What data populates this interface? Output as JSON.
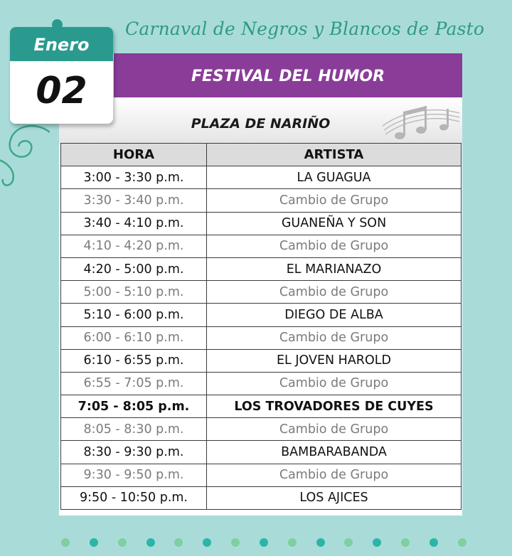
{
  "banner": {
    "title": "Carnaval de Negros y Blancos de Pasto"
  },
  "date": {
    "month": "Enero",
    "day": "02"
  },
  "festival": {
    "title": "FESTIVAL DEL HUMOR",
    "venue": "PLAZA DE NARIÑO"
  },
  "table": {
    "headers": [
      "HORA",
      "ARTISTA"
    ],
    "rows": [
      {
        "time": "3:00 - 3:30 p.m.",
        "artist": "LA GUAGUA",
        "kind": "act"
      },
      {
        "time": "3:30 - 3:40 p.m.",
        "artist": "Cambio de Grupo",
        "kind": "change"
      },
      {
        "time": "3:40 - 4:10 p.m.",
        "artist": "GUANEÑA Y SON",
        "kind": "act"
      },
      {
        "time": "4:10 - 4:20 p.m.",
        "artist": "Cambio de Grupo",
        "kind": "change"
      },
      {
        "time": "4:20 - 5:00 p.m.",
        "artist": "EL MARIANAZO",
        "kind": "act"
      },
      {
        "time": "5:00 - 5:10 p.m.",
        "artist": "Cambio de Grupo",
        "kind": "change"
      },
      {
        "time": "5:10 - 6:00 p.m.",
        "artist": "DIEGO DE ALBA",
        "kind": "act"
      },
      {
        "time": "6:00 - 6:10 p.m.",
        "artist": "Cambio de Grupo",
        "kind": "change"
      },
      {
        "time": "6:10 - 6:55 p.m.",
        "artist": "EL JOVEN HAROLD",
        "kind": "act"
      },
      {
        "time": "6:55 - 7:05 p.m.",
        "artist": "Cambio de Grupo",
        "kind": "change"
      },
      {
        "time": "7:05 - 8:05 p.m.",
        "artist": "LOS TROVADORES DE CUYES",
        "kind": "act-bold"
      },
      {
        "time": "8:05 - 8:30 p.m.",
        "artist": "Cambio de Grupo",
        "kind": "change"
      },
      {
        "time": "8:30 - 9:30 p.m.",
        "artist": "BAMBARABANDA",
        "kind": "act"
      },
      {
        "time": "9:30 - 9:50 p.m.",
        "artist": "Cambio de Grupo",
        "kind": "change"
      },
      {
        "time": "9:50 - 10:50 p.m.",
        "artist": "LOS AJICES",
        "kind": "act"
      }
    ]
  },
  "colors": {
    "background": "#a9dcd9",
    "teal": "#2b9a8e",
    "purple": "#8a3c99",
    "dot_teal": "#2bb5a8",
    "dot_green": "#7fcfa0"
  },
  "icons": {
    "decoration": "music-notes-icon",
    "swirl": "swirl-ornament-icon"
  }
}
